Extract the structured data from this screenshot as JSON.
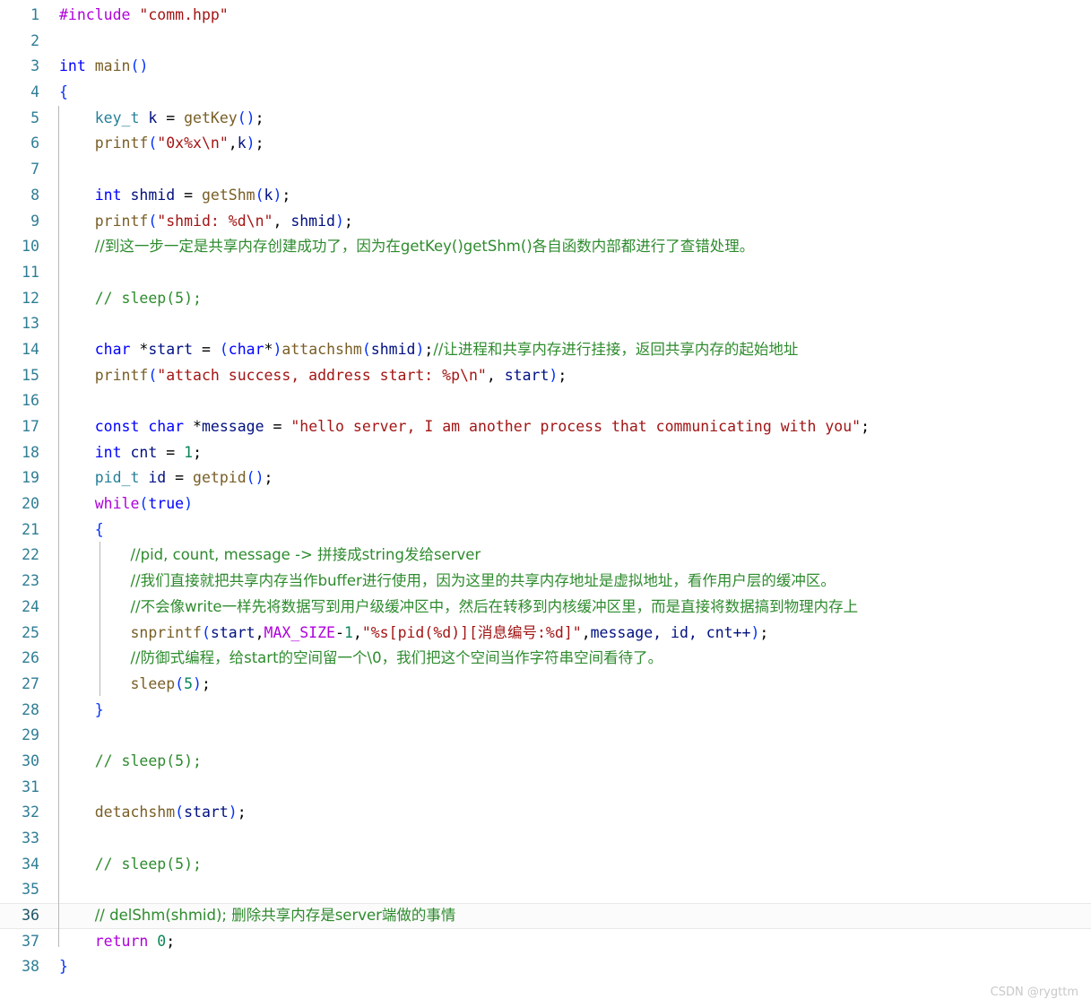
{
  "editor": {
    "title": "code-viewer",
    "language": "C++",
    "watermark": "CSDN @rygttm",
    "current_line": 36,
    "total_lines": 38,
    "colors": {
      "background": "#ffffff",
      "gutter_text": "#2f7d95",
      "current_line_bg": "#fbfbfb",
      "current_line_border": "#e8e8e8",
      "preprocessor": "#af00db",
      "string": "#a31515",
      "keyword": "#0000ff",
      "control": "#af00db",
      "type": "#267f99",
      "function": "#795e26",
      "variable": "#001080",
      "number": "#098658",
      "comment": "#2e8b2e",
      "macro": "#af00db",
      "paren": "#0431fa",
      "indent_guide": "#b8b8b8",
      "watermark": "#c9c9c9"
    }
  },
  "lines": [
    {
      "n": 1,
      "text": "#include \"comm.hpp\""
    },
    {
      "n": 2,
      "text": ""
    },
    {
      "n": 3,
      "text": "int main()"
    },
    {
      "n": 4,
      "text": "{"
    },
    {
      "n": 5,
      "text": "    key_t k = getKey();"
    },
    {
      "n": 6,
      "text": "    printf(\"0x%x\\n\",k);"
    },
    {
      "n": 7,
      "text": ""
    },
    {
      "n": 8,
      "text": "    int shmid = getShm(k);"
    },
    {
      "n": 9,
      "text": "    printf(\"shmid: %d\\n\", shmid);"
    },
    {
      "n": 10,
      "text": "    //到这一步一定是共享内存创建成功了，因为在getKey()getShm()各自函数内部都进行了查错处理。"
    },
    {
      "n": 11,
      "text": ""
    },
    {
      "n": 12,
      "text": "    // sleep(5);"
    },
    {
      "n": 13,
      "text": ""
    },
    {
      "n": 14,
      "text": "    char *start = (char*)attachshm(shmid);//让进程和共享内存进行挂接，返回共享内存的起始地址"
    },
    {
      "n": 15,
      "text": "    printf(\"attach success, address start: %p\\n\", start);"
    },
    {
      "n": 16,
      "text": ""
    },
    {
      "n": 17,
      "text": "    const char *message = \"hello server, I am another process that communicating with you\";"
    },
    {
      "n": 18,
      "text": "    int cnt = 1;"
    },
    {
      "n": 19,
      "text": "    pid_t id = getpid();"
    },
    {
      "n": 20,
      "text": "    while(true)"
    },
    {
      "n": 21,
      "text": "    {"
    },
    {
      "n": 22,
      "text": "        //pid, count, message -> 拼接成string发给server"
    },
    {
      "n": 23,
      "text": "        //我们直接就把共享内存当作buffer进行使用，因为这里的共享内存地址是虚拟地址，看作用户层的缓冲区。"
    },
    {
      "n": 24,
      "text": "        //不会像write一样先将数据写到用户级缓冲区中，然后在转移到内核缓冲区里，而是直接将数据搞到物理内存上"
    },
    {
      "n": 25,
      "text": "        snprintf(start,MAX_SIZE-1,\"%s[pid(%d)][消息编号:%d]\",message, id, cnt++);"
    },
    {
      "n": 26,
      "text": "        //防御式编程，给start的空间留一个\\0，我们把这个空间当作字符串空间看待了。"
    },
    {
      "n": 27,
      "text": "        sleep(5);"
    },
    {
      "n": 28,
      "text": "    }"
    },
    {
      "n": 29,
      "text": ""
    },
    {
      "n": 30,
      "text": "    // sleep(5);"
    },
    {
      "n": 31,
      "text": ""
    },
    {
      "n": 32,
      "text": "    detachshm(start);"
    },
    {
      "n": 33,
      "text": ""
    },
    {
      "n": 34,
      "text": "    // sleep(5);"
    },
    {
      "n": 35,
      "text": ""
    },
    {
      "n": 36,
      "text": "    // delShm(shmid); 删除共享内存是server端做的事情"
    },
    {
      "n": 37,
      "text": "    return 0;"
    },
    {
      "n": 38,
      "text": "}"
    }
  ],
  "tokens": {
    "l1": [
      [
        "#include ",
        "tok-pre"
      ],
      [
        "\"comm.hpp\"",
        "tok-str"
      ]
    ],
    "l3": [
      [
        "int",
        "tok-kw"
      ],
      [
        " ",
        "tok-punct"
      ],
      [
        "main",
        "tok-fn"
      ],
      [
        "(",
        "tok-paren"
      ],
      [
        ")",
        "tok-paren"
      ]
    ],
    "l4": [
      [
        "{",
        "tok-brace"
      ]
    ],
    "l5": [
      [
        "key_t",
        "tok-type"
      ],
      [
        " ",
        "tok-punct"
      ],
      [
        "k",
        "tok-var"
      ],
      [
        " = ",
        "tok-punct"
      ],
      [
        "getKey",
        "tok-fn"
      ],
      [
        "(",
        "tok-paren"
      ],
      [
        ")",
        "tok-paren"
      ],
      [
        ";",
        "tok-punct"
      ]
    ],
    "l6": [
      [
        "printf",
        "tok-fn"
      ],
      [
        "(",
        "tok-paren"
      ],
      [
        "\"0x%x\\n\"",
        "tok-str"
      ],
      [
        ",",
        "tok-punct"
      ],
      [
        "k",
        "tok-var"
      ],
      [
        ")",
        "tok-paren"
      ],
      [
        ";",
        "tok-punct"
      ]
    ],
    "l8": [
      [
        "int",
        "tok-kw"
      ],
      [
        " ",
        "tok-punct"
      ],
      [
        "shmid",
        "tok-var"
      ],
      [
        " = ",
        "tok-punct"
      ],
      [
        "getShm",
        "tok-fn"
      ],
      [
        "(",
        "tok-paren"
      ],
      [
        "k",
        "tok-var"
      ],
      [
        ")",
        "tok-paren"
      ],
      [
        ";",
        "tok-punct"
      ]
    ],
    "l9": [
      [
        "printf",
        "tok-fn"
      ],
      [
        "(",
        "tok-paren"
      ],
      [
        "\"shmid: %d\\n\"",
        "tok-str"
      ],
      [
        ", ",
        "tok-punct"
      ],
      [
        "shmid",
        "tok-var"
      ],
      [
        ")",
        "tok-paren"
      ],
      [
        ";",
        "tok-punct"
      ]
    ],
    "l12": [
      [
        "// sleep(5);",
        "tok-cmt"
      ]
    ],
    "l14": [
      [
        "char",
        "tok-kw"
      ],
      [
        " *",
        "tok-punct"
      ],
      [
        "start",
        "tok-var"
      ],
      [
        " = ",
        "tok-punct"
      ],
      [
        "(",
        "tok-paren"
      ],
      [
        "char",
        "tok-kw"
      ],
      [
        "*",
        "tok-punct"
      ],
      [
        ")",
        "tok-paren"
      ],
      [
        "attachshm",
        "tok-fn"
      ],
      [
        "(",
        "tok-paren"
      ],
      [
        "shmid",
        "tok-var"
      ],
      [
        ")",
        "tok-paren"
      ],
      [
        ";",
        "tok-punct"
      ]
    ],
    "l15": [
      [
        "printf",
        "tok-fn"
      ],
      [
        "(",
        "tok-paren"
      ],
      [
        "\"attach success, address start: %p\\n\"",
        "tok-str"
      ],
      [
        ", ",
        "tok-punct"
      ],
      [
        "start",
        "tok-var"
      ],
      [
        ")",
        "tok-paren"
      ],
      [
        ";",
        "tok-punct"
      ]
    ],
    "l17": [
      [
        "const",
        "tok-kw"
      ],
      [
        " ",
        "tok-punct"
      ],
      [
        "char",
        "tok-kw"
      ],
      [
        " *",
        "tok-punct"
      ],
      [
        "message",
        "tok-var"
      ],
      [
        " = ",
        "tok-punct"
      ],
      [
        "\"hello server, I am another process that communicating with you\"",
        "tok-str"
      ],
      [
        ";",
        "tok-punct"
      ]
    ],
    "l18": [
      [
        "int",
        "tok-kw"
      ],
      [
        " ",
        "tok-punct"
      ],
      [
        "cnt",
        "tok-var"
      ],
      [
        " = ",
        "tok-punct"
      ],
      [
        "1",
        "tok-num"
      ],
      [
        ";",
        "tok-punct"
      ]
    ],
    "l19": [
      [
        "pid_t",
        "tok-type"
      ],
      [
        " ",
        "tok-punct"
      ],
      [
        "id",
        "tok-var"
      ],
      [
        " = ",
        "tok-punct"
      ],
      [
        "getpid",
        "tok-fn"
      ],
      [
        "(",
        "tok-paren"
      ],
      [
        ")",
        "tok-paren"
      ],
      [
        ";",
        "tok-punct"
      ]
    ],
    "l20": [
      [
        "while",
        "tok-ctl"
      ],
      [
        "(",
        "tok-paren"
      ],
      [
        "true",
        "tok-kw"
      ],
      [
        ")",
        "tok-paren"
      ]
    ],
    "l21": [
      [
        "{",
        "tok-brace"
      ]
    ],
    "l27": [
      [
        "sleep",
        "tok-fn"
      ],
      [
        "(",
        "tok-paren"
      ],
      [
        "5",
        "tok-num"
      ],
      [
        ")",
        "tok-paren"
      ],
      [
        ";",
        "tok-punct"
      ]
    ],
    "l28": [
      [
        "}",
        "tok-brace"
      ]
    ],
    "l30": [
      [
        "// sleep(5);",
        "tok-cmt"
      ]
    ],
    "l32": [
      [
        "detachshm",
        "tok-fn"
      ],
      [
        "(",
        "tok-paren"
      ],
      [
        "start",
        "tok-var"
      ],
      [
        ")",
        "tok-paren"
      ],
      [
        ";",
        "tok-punct"
      ]
    ],
    "l34": [
      [
        "// sleep(5);",
        "tok-cmt"
      ]
    ],
    "l37": [
      [
        "return",
        "tok-ctl"
      ],
      [
        " ",
        "tok-punct"
      ],
      [
        "0",
        "tok-num"
      ],
      [
        ";",
        "tok-punct"
      ]
    ],
    "l38": [
      [
        "}",
        "tok-brace"
      ]
    ]
  },
  "comment_lines": {
    "l10": "//到这一步一定是共享内存创建成功了，因为在getKey()getShm()各自函数内部都进行了查错处理。",
    "l14_trail": "//让进程和共享内存进行挂接，返回共享内存的起始地址",
    "l22": "//pid, count, message -> 拼接成string发给server",
    "l23": "//我们直接就把共享内存当作buffer进行使用，因为这里的共享内存地址是虚拟地址，看作用户层的缓冲区。",
    "l24": "//不会像write一样先将数据写到用户级缓冲区中，然后在转移到内核缓冲区里，而是直接将数据搞到物理内存上",
    "l26": "//防御式编程，给start的空间留一个\\0，我们把这个空间当作字符串空间看待了。",
    "l36": "// delShm(shmid); 删除共享内存是server端做的事情"
  },
  "line25": {
    "fn": "snprintf",
    "arg_start": "start",
    "macro": "MAX_SIZE",
    "minus": "-",
    "one": "1",
    "str_open": "\"%s",
    "br1": "[",
    "pid": "pid",
    "p1": "(",
    "d1": "%d",
    "p2": ")",
    "br2": "]",
    "br3": "[",
    "cjk": "消息编号",
    "colon_d": ":%d",
    "br4": "]",
    "str_close": "\"",
    "args_rest": "message, id, cnt++",
    "semi": ";"
  }
}
